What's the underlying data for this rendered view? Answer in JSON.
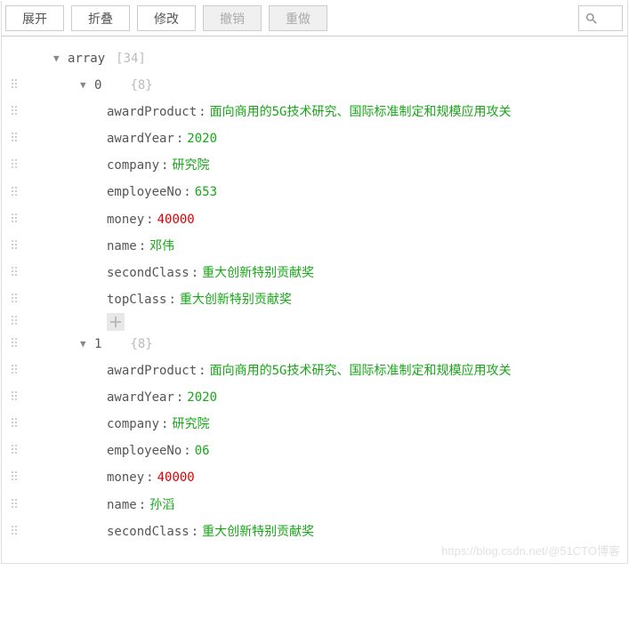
{
  "toolbar": {
    "expand": "展开",
    "collapse": "折叠",
    "modify": "修改",
    "undo": "撤销",
    "redo": "重做"
  },
  "root": {
    "label": "array",
    "count": "[34]"
  },
  "items": [
    {
      "idx": "0",
      "count": "{8}",
      "fields": [
        {
          "key": "awardProduct",
          "value": "面向商用的5G技术研究、国际标准制定和规模应用攻关",
          "type": "str"
        },
        {
          "key": "awardYear",
          "value": "2020",
          "type": "str"
        },
        {
          "key": "company",
          "value": "研究院",
          "type": "str"
        },
        {
          "key": "employeeNo",
          "mask": "       ",
          "value": "653",
          "type": "str"
        },
        {
          "key": "money",
          "value": "40000",
          "type": "num"
        },
        {
          "key": "name",
          "value": "邓伟",
          "type": "str"
        },
        {
          "key": "secondClass",
          "value": "重大创新特别贡献奖",
          "type": "str"
        },
        {
          "key": "topClass",
          "value": "重大创新特别贡献奖",
          "type": "str"
        }
      ]
    },
    {
      "idx": "1",
      "count": "{8}",
      "fields": [
        {
          "key": "awardProduct",
          "value": "面向商用的5G技术研究、国际标准制定和规模应用攻关",
          "type": "str"
        },
        {
          "key": "awardYear",
          "value": "2020",
          "type": "str"
        },
        {
          "key": "company",
          "value": "研究院",
          "type": "str"
        },
        {
          "key": "employeeNo",
          "mask": "        ",
          "value": "06",
          "type": "str"
        },
        {
          "key": "money",
          "value": "40000",
          "type": "num"
        },
        {
          "key": "name",
          "value": "孙滔",
          "type": "str"
        },
        {
          "key": "secondClass",
          "value": "重大创新特别贡献奖",
          "type": "str"
        }
      ]
    }
  ],
  "watermark": "https://blog.csdn.net/@51CTO博客"
}
